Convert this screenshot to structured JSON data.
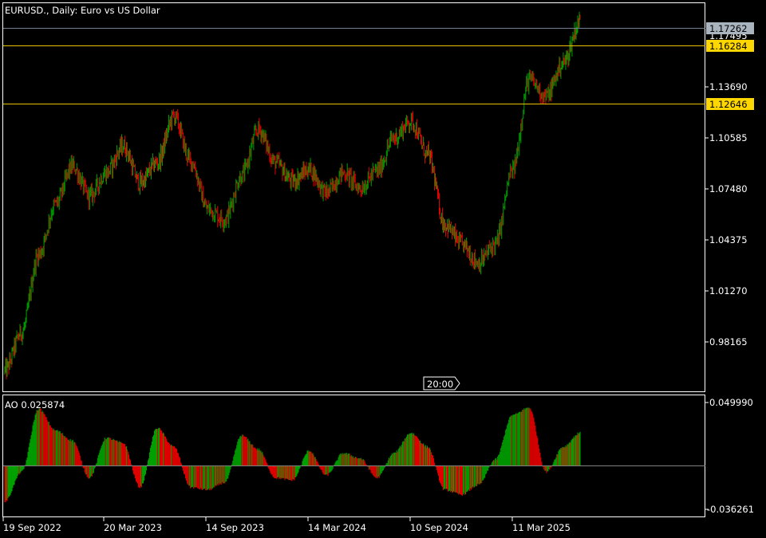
{
  "header": {
    "symbol": "EURUSD.",
    "timeframe": "Daily",
    "description": "Euro vs US Dollar",
    "title_text": "EURUSD., Daily:  Euro vs US Dollar"
  },
  "colors": {
    "background": "#000000",
    "frame": "#ffffff",
    "bull": "#00a000",
    "bear": "#e00000",
    "level_line": "#e8c000",
    "level_badge": "#ffd700",
    "ask_line": "#708090",
    "ask_badge": "#a9b4bf"
  },
  "price_levels": {
    "current_price": "1.17262",
    "hidden_label": "1.17495",
    "level_1": "1.16284",
    "level_2": "1.12646"
  },
  "crosshair": {
    "time_label": "20:00"
  },
  "indicator": {
    "name": "AO",
    "value": "0.025874",
    "label": "AO 0.025874",
    "max_label": "0.049990",
    "min_label": "-0.036261"
  },
  "chart_data": [
    {
      "type": "candlestick",
      "title": "EURUSD., Daily:  Euro vs US Dollar",
      "x_tick_labels": [
        "19 Sep 2022",
        "20 Mar 2023",
        "14 Sep 2023",
        "14 Mar 2024",
        "10 Sep 2024",
        "11 Mar 2025"
      ],
      "y_tick_labels": [
        "1.13690",
        "1.10585",
        "1.07480",
        "1.04375",
        "1.01270",
        "0.98165"
      ],
      "y_ticks": [
        1.1369,
        1.10585,
        1.0748,
        1.04375,
        1.0127,
        0.98165
      ],
      "ylim": [
        0.953,
        1.1855
      ],
      "x": [
        "2022-09",
        "2022-10",
        "2022-11",
        "2022-12",
        "2023-01",
        "2023-02",
        "2023-03",
        "2023-04",
        "2023-05",
        "2023-06",
        "2023-07",
        "2023-08",
        "2023-09",
        "2023-10",
        "2023-11",
        "2023-12",
        "2024-01",
        "2024-02",
        "2024-03",
        "2024-04",
        "2024-05",
        "2024-06",
        "2024-07",
        "2024-08",
        "2024-09",
        "2024-10",
        "2024-11",
        "2024-12",
        "2025-01",
        "2025-02",
        "2025-03",
        "2025-04",
        "2025-05",
        "2025-06",
        "2025-07"
      ],
      "close_values": [
        0.965,
        0.988,
        1.035,
        1.065,
        1.088,
        1.07,
        1.084,
        1.1,
        1.078,
        1.09,
        1.118,
        1.091,
        1.062,
        1.056,
        1.082,
        1.11,
        1.09,
        1.079,
        1.086,
        1.072,
        1.084,
        1.075,
        1.085,
        1.105,
        1.115,
        1.095,
        1.053,
        1.041,
        1.03,
        1.041,
        1.085,
        1.14,
        1.13,
        1.15,
        1.175
      ],
      "horizontal_levels": [
        1.17262,
        1.16284,
        1.12646
      ]
    },
    {
      "type": "bar",
      "title": "AO 0.025874",
      "y_tick_labels": [
        "0.049990",
        "-0.036261"
      ],
      "ylim": [
        -0.036261,
        0.04999
      ],
      "x": [
        "2022-09",
        "2022-10",
        "2022-11",
        "2022-12",
        "2023-01",
        "2023-02",
        "2023-03",
        "2023-04",
        "2023-05",
        "2023-06",
        "2023-07",
        "2023-08",
        "2023-09",
        "2023-10",
        "2023-11",
        "2023-12",
        "2024-01",
        "2024-02",
        "2024-03",
        "2024-04",
        "2024-05",
        "2024-06",
        "2024-07",
        "2024-08",
        "2024-09",
        "2024-10",
        "2024-11",
        "2024-12",
        "2025-01",
        "2025-02",
        "2025-03",
        "2025-04",
        "2025-05",
        "2025-06",
        "2025-07"
      ],
      "values": [
        -0.03,
        -0.005,
        0.045,
        0.028,
        0.02,
        -0.01,
        0.022,
        0.018,
        -0.018,
        0.03,
        0.015,
        -0.018,
        -0.02,
        -0.014,
        0.024,
        0.013,
        -0.01,
        -0.012,
        0.012,
        -0.008,
        0.01,
        0.006,
        -0.01,
        0.01,
        0.026,
        0.015,
        -0.02,
        -0.024,
        -0.016,
        0.005,
        0.04,
        0.046,
        -0.005,
        0.015,
        0.026
      ]
    }
  ]
}
